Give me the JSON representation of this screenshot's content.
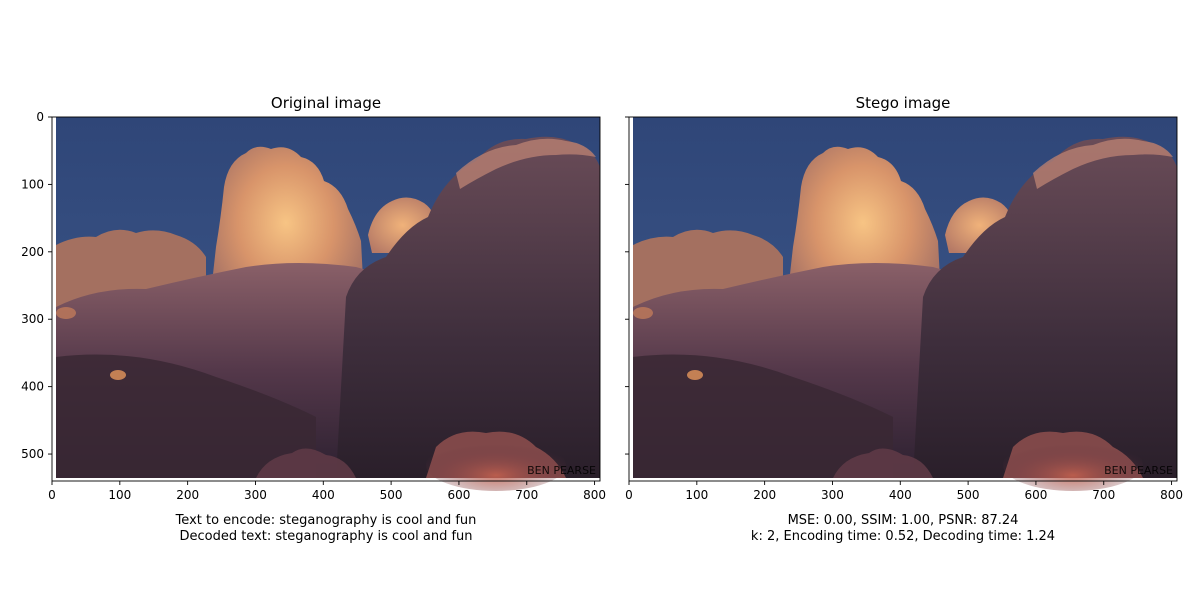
{
  "figure": {
    "watermark": "BEN PEARSE"
  },
  "chart_data": [
    {
      "type": "image",
      "title": "Original image",
      "x_ticks": [
        0,
        100,
        200,
        300,
        400,
        500,
        600,
        700,
        800
      ],
      "y_ticks": [
        0,
        100,
        200,
        300,
        400,
        500
      ],
      "xlim": [
        0,
        808
      ],
      "ylim": [
        540,
        0
      ],
      "y_inverted": true,
      "caption_lines": [
        "Text to encode: steganography is cool and fun",
        "Decoded text: steganography is cool and fun"
      ]
    },
    {
      "type": "image",
      "title": "Stego image",
      "x_ticks": [
        0,
        100,
        200,
        300,
        400,
        500,
        600,
        700,
        800
      ],
      "y_ticks": [
        0,
        100,
        200,
        300,
        400,
        500
      ],
      "xlim": [
        0,
        808
      ],
      "ylim": [
        540,
        0
      ],
      "y_inverted": true,
      "y_tick_labels_visible": false,
      "caption_lines": [
        "MSE: 0.00, SSIM: 1.00, PSNR: 87.24",
        "k: 2, Encoding time: 0.52, Decoding time: 1.24"
      ]
    }
  ],
  "colors": {
    "sky": "#3d5688",
    "sky_top": "#2f4678",
    "cloud_bright": "#f2b779",
    "cloud_mid": "#b07a64",
    "cloud_dark": "#3d2c36",
    "cloud_shadow": "#2a1f2a",
    "cloud_pink": "#b85c5c"
  }
}
